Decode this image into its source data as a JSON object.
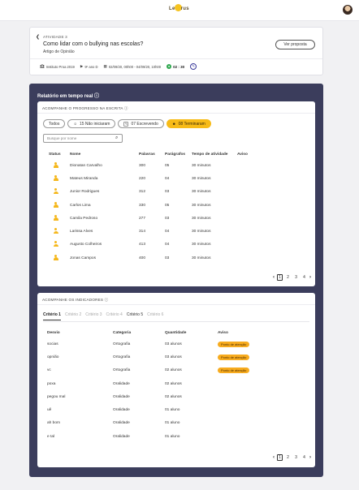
{
  "header": {
    "logo_text": "Letrus",
    "avatar": "avatar"
  },
  "activity": {
    "label": "ATIVIDADE 3",
    "title": "Como lidar com o bullying nas escolas?",
    "subtitle": "Artigo de Opinião",
    "view_button": "Ver proposta",
    "school": "Instituto Proa 2019",
    "class": "9º ano D",
    "dates": "02/09/20, 00h00 - 04/09/20, 10h00",
    "timer_value": "02 : 30"
  },
  "realtime": {
    "title": "Relatório em tempo real",
    "progress": {
      "heading": "ACOMPANHE O PROGRESSO NA ESCRITA",
      "filters": [
        {
          "label": "Todos",
          "active": false
        },
        {
          "label": "15 Não iniciaram",
          "active": false
        },
        {
          "label": "07 Escrevendo",
          "active": false
        },
        {
          "label": "08 Terminaram",
          "active": true
        }
      ],
      "search_placeholder": "Busque por nome",
      "columns": [
        "Status",
        "Nome",
        "Palavras",
        "Parágrafos",
        "Tempo de atividade",
        "Aviso"
      ],
      "rows": [
        {
          "name": "Dionatan Carvalho",
          "words": "300",
          "paragraphs": "05",
          "time": "30 minutos",
          "warning": ""
        },
        {
          "name": "Mateus Miranda",
          "words": "220",
          "paragraphs": "04",
          "time": "30 minutos",
          "warning": ""
        },
        {
          "name": "Junior Rodrigues",
          "words": "312",
          "paragraphs": "03",
          "time": "30 minutos",
          "warning": ""
        },
        {
          "name": "Carlos Lima",
          "words": "330",
          "paragraphs": "05",
          "time": "30 minutos",
          "warning": ""
        },
        {
          "name": "Camila Pedroso",
          "words": "277",
          "paragraphs": "03",
          "time": "30 minutos",
          "warning": ""
        },
        {
          "name": "Larissa Alves",
          "words": "314",
          "paragraphs": "04",
          "time": "30 minutos",
          "warning": ""
        },
        {
          "name": "Augusto Colheiros",
          "words": "413",
          "paragraphs": "04",
          "time": "30 minutos",
          "warning": ""
        },
        {
          "name": "Jonas Campos",
          "words": "400",
          "paragraphs": "03",
          "time": "30 minutos",
          "warning": ""
        }
      ],
      "pages": [
        "1",
        "2",
        "3",
        "4"
      ]
    },
    "indicators": {
      "heading": "ACOMPANHE OS INDICADORES",
      "tabs": [
        "Critério 1",
        "Critério 2",
        "Critério 3",
        "Critério 4",
        "Critério 5",
        "Critério 6"
      ],
      "columns": [
        "Desvio",
        "Categoria",
        "Quantidade",
        "Aviso"
      ],
      "rows": [
        {
          "deviation": "socias",
          "category": "Ortografia",
          "quantity": "03 alunos",
          "warning": "Ponto de atenção"
        },
        {
          "deviation": "opnião",
          "category": "Ortografia",
          "quantity": "03 alunos",
          "warning": "Ponto de atenção"
        },
        {
          "deviation": "vc",
          "category": "Ortografia",
          "quantity": "02 alunos",
          "warning": "Ponto de atenção"
        },
        {
          "deviation": "poxa",
          "category": "Oralidade",
          "quantity": "02 alunos",
          "warning": ""
        },
        {
          "deviation": "pegou mal",
          "category": "Oralidade",
          "quantity": "02 alunos",
          "warning": ""
        },
        {
          "deviation": "uê",
          "category": "Oralidade",
          "quantity": "01 aluno",
          "warning": ""
        },
        {
          "deviation": "ah bom",
          "category": "Oralidade",
          "quantity": "01 aluno",
          "warning": ""
        },
        {
          "deviation": "e tal",
          "category": "Oralidade",
          "quantity": "01 aluno",
          "warning": ""
        }
      ],
      "pages": [
        "1",
        "2",
        "3",
        "4"
      ]
    }
  },
  "colors": {
    "accent": "#f7bb18",
    "panel": "#3b3d5c",
    "timer": "#2fa84f",
    "warning": "#f7ab1e"
  }
}
